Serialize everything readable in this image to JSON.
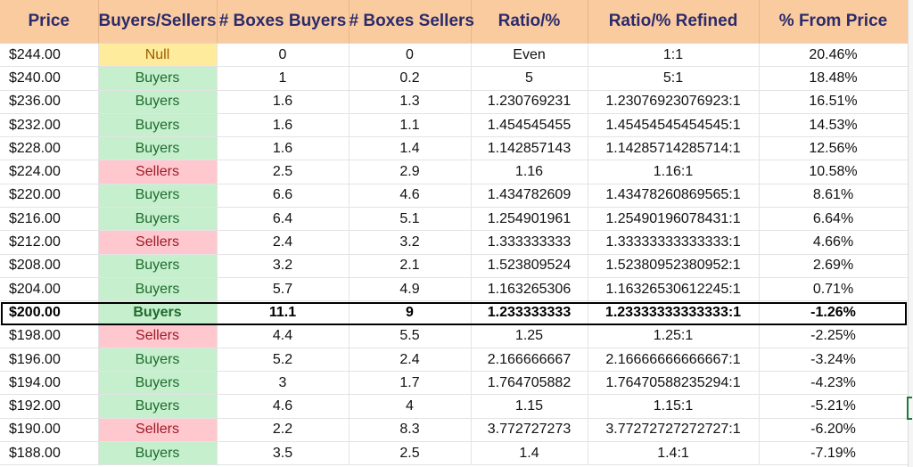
{
  "columns": [
    "Price",
    "Buyers/Sellers",
    "# Boxes Buyers",
    "# Boxes Sellers",
    "Ratio/%",
    "Ratio/% Refined",
    "% From Price"
  ],
  "rows": [
    [
      "$244.00",
      "Null",
      "0",
      "0",
      "Even",
      "1:1",
      "20.46%"
    ],
    [
      "$240.00",
      "Buyers",
      "1",
      "0.2",
      "5",
      "5:1",
      "18.48%"
    ],
    [
      "$236.00",
      "Buyers",
      "1.6",
      "1.3",
      "1.230769231",
      "1.23076923076923:1",
      "16.51%"
    ],
    [
      "$232.00",
      "Buyers",
      "1.6",
      "1.1",
      "1.454545455",
      "1.45454545454545:1",
      "14.53%"
    ],
    [
      "$228.00",
      "Buyers",
      "1.6",
      "1.4",
      "1.142857143",
      "1.14285714285714:1",
      "12.56%"
    ],
    [
      "$224.00",
      "Sellers",
      "2.5",
      "2.9",
      "1.16",
      "1.16:1",
      "10.58%"
    ],
    [
      "$220.00",
      "Buyers",
      "6.6",
      "4.6",
      "1.434782609",
      "1.43478260869565:1",
      "8.61%"
    ],
    [
      "$216.00",
      "Buyers",
      "6.4",
      "5.1",
      "1.254901961",
      "1.25490196078431:1",
      "6.64%"
    ],
    [
      "$212.00",
      "Sellers",
      "2.4",
      "3.2",
      "1.333333333",
      "1.33333333333333:1",
      "4.66%"
    ],
    [
      "$208.00",
      "Buyers",
      "3.2",
      "2.1",
      "1.523809524",
      "1.52380952380952:1",
      "2.69%"
    ],
    [
      "$204.00",
      "Buyers",
      "5.7",
      "4.9",
      "1.163265306",
      "1.16326530612245:1",
      "0.71%"
    ],
    [
      "$200.00",
      "Buyers",
      "11.1",
      "9",
      "1.233333333",
      "1.23333333333333:1",
      "-1.26%"
    ],
    [
      "$198.00",
      "Sellers",
      "4.4",
      "5.5",
      "1.25",
      "1.25:1",
      "-2.25%"
    ],
    [
      "$196.00",
      "Buyers",
      "5.2",
      "2.4",
      "2.166666667",
      "2.16666666666667:1",
      "-3.24%"
    ],
    [
      "$194.00",
      "Buyers",
      "3",
      "1.7",
      "1.764705882",
      "1.76470588235294:1",
      "-4.23%"
    ],
    [
      "$192.00",
      "Buyers",
      "4.6",
      "4",
      "1.15",
      "1.15:1",
      "-5.21%"
    ],
    [
      "$190.00",
      "Sellers",
      "2.2",
      "8.3",
      "3.772727273",
      "3.77272727272727:1",
      "-6.20%"
    ],
    [
      "$188.00",
      "Buyers",
      "3.5",
      "2.5",
      "1.4",
      "1.4:1",
      "-7.19%"
    ]
  ],
  "highlighted_row_index": 11,
  "colors": {
    "header_bg": "#fbcba0",
    "header_text": "#2b2b6b",
    "buyers_fill": "#c6efce",
    "buyers_text": "#1e6b2c",
    "sellers_fill": "#ffc7ce",
    "sellers_text": "#9c1c28",
    "null_fill": "#ffeb9c",
    "null_text": "#9c5c00"
  }
}
